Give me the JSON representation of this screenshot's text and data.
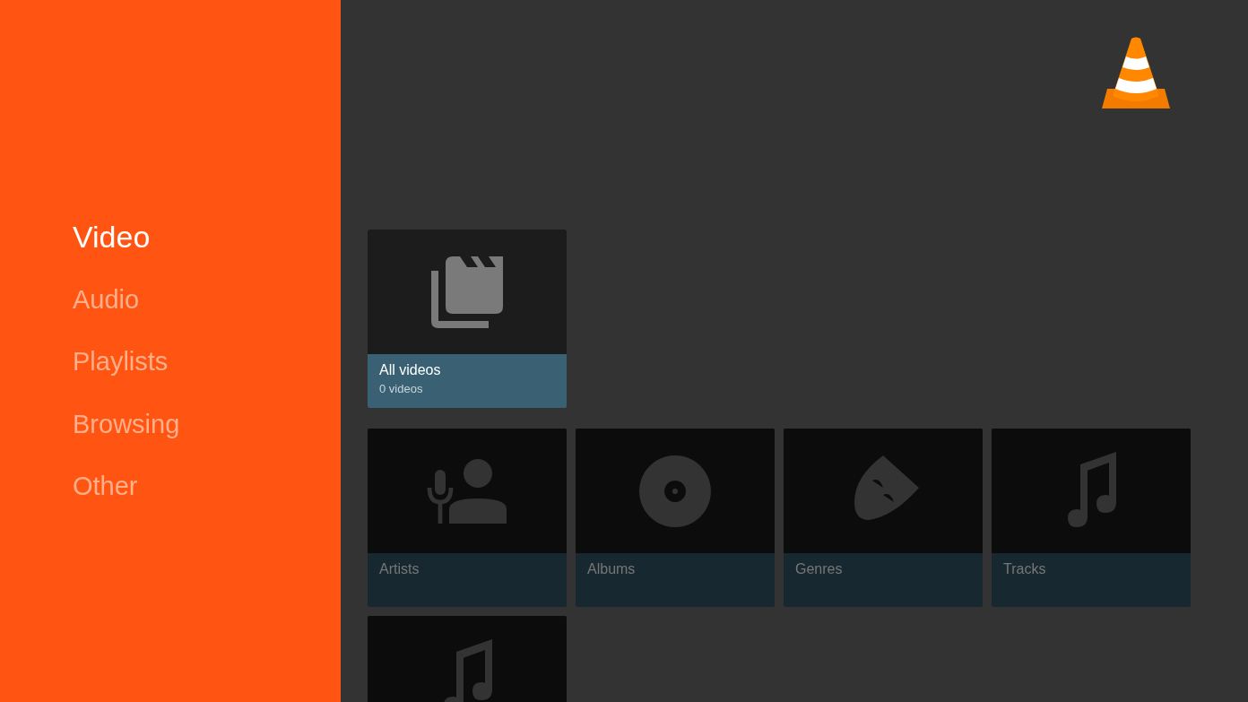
{
  "sidebar": {
    "items": [
      {
        "label": "Video",
        "selected": true
      },
      {
        "label": "Audio",
        "selected": false
      },
      {
        "label": "Playlists",
        "selected": false
      },
      {
        "label": "Browsing",
        "selected": false
      },
      {
        "label": "Other",
        "selected": false
      }
    ]
  },
  "rows": [
    {
      "cards": [
        {
          "kind": "videos",
          "title": "All videos",
          "subtitle": "0 videos",
          "focused": true
        }
      ]
    },
    {
      "cards": [
        {
          "kind": "artists",
          "title": "Artists",
          "focused": false
        },
        {
          "kind": "albums",
          "title": "Albums",
          "focused": false
        },
        {
          "kind": "genres",
          "title": "Genres",
          "focused": false
        },
        {
          "kind": "tracks",
          "title": "Tracks",
          "focused": false
        }
      ]
    },
    {
      "cards": [
        {
          "kind": "tracks",
          "focused": false
        }
      ]
    }
  ]
}
